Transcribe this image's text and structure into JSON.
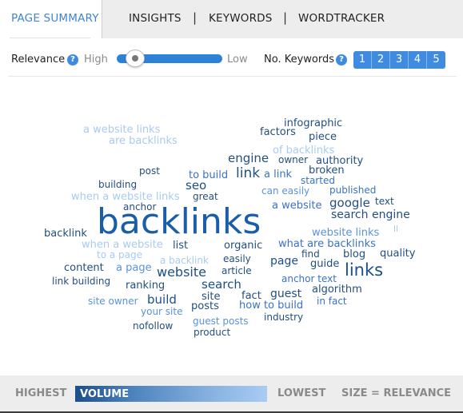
{
  "tabs": [
    {
      "label": "PAGE SUMMARY",
      "active": true
    },
    {
      "label": "INSIGHTS",
      "active": false
    },
    {
      "label": "KEYWORDS",
      "active": false
    },
    {
      "label": "WORDTRACKER",
      "active": false
    }
  ],
  "tab_separator": "|",
  "controls": {
    "relevance_label": "Relevance",
    "help_glyph": "?",
    "high_label": "High",
    "low_label": "Low",
    "relevance_value": 0.12,
    "keywords_label": "No. Keywords",
    "keyword_buttons": [
      "1",
      "2",
      "3",
      "4",
      "5"
    ]
  },
  "cloud": {
    "accent_colors": {
      "darkest": "#1b4f86",
      "dark": "#244f7d",
      "mid": "#3a72c4",
      "light": "#5a93db",
      "lightest": "#a8cbf1",
      "main": "#1a5ea8"
    },
    "words": [
      {
        "text": "infographic"
      },
      {
        "text": "a website links"
      },
      {
        "text": "factors"
      },
      {
        "text": "piece"
      },
      {
        "text": "are backlinks"
      },
      {
        "text": "of backlinks"
      },
      {
        "text": "engine"
      },
      {
        "text": "owner"
      },
      {
        "text": "authority"
      },
      {
        "text": "post"
      },
      {
        "text": "to build"
      },
      {
        "text": "link"
      },
      {
        "text": "a link"
      },
      {
        "text": "broken"
      },
      {
        "text": "building"
      },
      {
        "text": "seo"
      },
      {
        "text": "started"
      },
      {
        "text": "can easily"
      },
      {
        "text": "published"
      },
      {
        "text": "when a website links"
      },
      {
        "text": "great"
      },
      {
        "text": "anchor"
      },
      {
        "text": "a website"
      },
      {
        "text": "google"
      },
      {
        "text": "text"
      },
      {
        "text": "backlinks"
      },
      {
        "text": "search engine"
      },
      {
        "text": "backlink"
      },
      {
        "text": "website links"
      },
      {
        "text": "ll"
      },
      {
        "text": "when a website"
      },
      {
        "text": "list"
      },
      {
        "text": "organic"
      },
      {
        "text": "what are backlinks"
      },
      {
        "text": "to a page"
      },
      {
        "text": "a backlink"
      },
      {
        "text": "easily"
      },
      {
        "text": "find"
      },
      {
        "text": "blog"
      },
      {
        "text": "quality"
      },
      {
        "text": "page"
      },
      {
        "text": "guide"
      },
      {
        "text": "content"
      },
      {
        "text": "a page"
      },
      {
        "text": "website"
      },
      {
        "text": "article"
      },
      {
        "text": "links"
      },
      {
        "text": "link building"
      },
      {
        "text": "anchor text"
      },
      {
        "text": "ranking"
      },
      {
        "text": "search"
      },
      {
        "text": "algorithm"
      },
      {
        "text": "site"
      },
      {
        "text": "fact"
      },
      {
        "text": "guest"
      },
      {
        "text": "site owner"
      },
      {
        "text": "build"
      },
      {
        "text": "in fact"
      },
      {
        "text": "posts"
      },
      {
        "text": "how to build"
      },
      {
        "text": "your site"
      },
      {
        "text": "industry"
      },
      {
        "text": "guest posts"
      },
      {
        "text": "nofollow"
      },
      {
        "text": "product"
      }
    ]
  },
  "legend": {
    "highest": "HIGHEST",
    "volume": "VOLUME",
    "lowest": "LOWEST",
    "size_note": "SIZE = RELEVANCE"
  }
}
